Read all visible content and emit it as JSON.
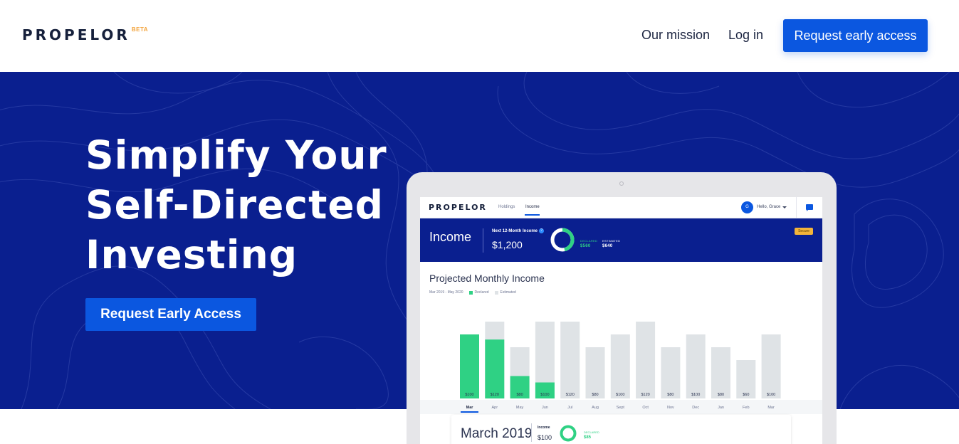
{
  "header": {
    "logo": "PROPELOR",
    "logo_badge": "BETA",
    "nav_mission": "Our mission",
    "nav_login": "Log in",
    "cta": "Request early access"
  },
  "hero": {
    "title_lines": [
      "Simplify Your",
      "Self-Directed",
      "Investing"
    ],
    "cta": "Request Early Access",
    "background_color": "#0a1f8f",
    "accent_color": "#0b57e0"
  },
  "app": {
    "logo": "PROPELOR",
    "tabs": [
      "Holdings",
      "Income"
    ],
    "active_tab": "Income",
    "avatar_initial": "G",
    "greeting": "Hello, Grace",
    "lock_label": "Secure",
    "income_title": "Income",
    "next_label": "Next 12-Month Income",
    "next_value": "$1,200",
    "declared_label": "DECLARED",
    "declared_value": "$560",
    "estimated_label": "ESTIMATED",
    "estimated_value": "$640",
    "chart_title": "Projected Monthly Income",
    "chart_range": "Mar 2019 - May 2020",
    "legend_declared": "Declared",
    "legend_estimated": "Estimated",
    "declared_color": "#2fd184",
    "estimated_color": "#dfe3e6",
    "selected_month": "Mar",
    "detail_month": "March 2019",
    "detail_label": "Income",
    "detail_value": "$100",
    "detail_declared_label": "DECLARED",
    "detail_declared_value": "$85"
  },
  "chart_data": {
    "type": "bar",
    "title": "Projected Monthly Income",
    "subtitle": "Mar 2019 - May 2020",
    "categories": [
      "Mar",
      "Apr",
      "May",
      "Jun",
      "Jul",
      "Aug",
      "Sept",
      "Oct",
      "Nov",
      "Dec",
      "Jan",
      "Feb",
      "Mar"
    ],
    "series": [
      {
        "name": "Declared",
        "values": [
          100,
          92,
          35,
          25,
          0,
          0,
          0,
          0,
          0,
          0,
          0,
          0,
          0
        ]
      },
      {
        "name": "Estimated",
        "values": [
          0,
          28,
          45,
          95,
          120,
          80,
          100,
          120,
          80,
          100,
          80,
          60,
          100
        ]
      }
    ],
    "bar_labels": [
      "$100",
      "$120",
      "$80",
      "$100",
      "$120",
      "$80",
      "$100",
      "$120",
      "$80",
      "$100",
      "$80",
      "$60",
      "$100"
    ],
    "ylim": [
      0,
      120
    ],
    "xlabel": "",
    "ylabel": "",
    "grid": false,
    "legend": "top-left"
  }
}
